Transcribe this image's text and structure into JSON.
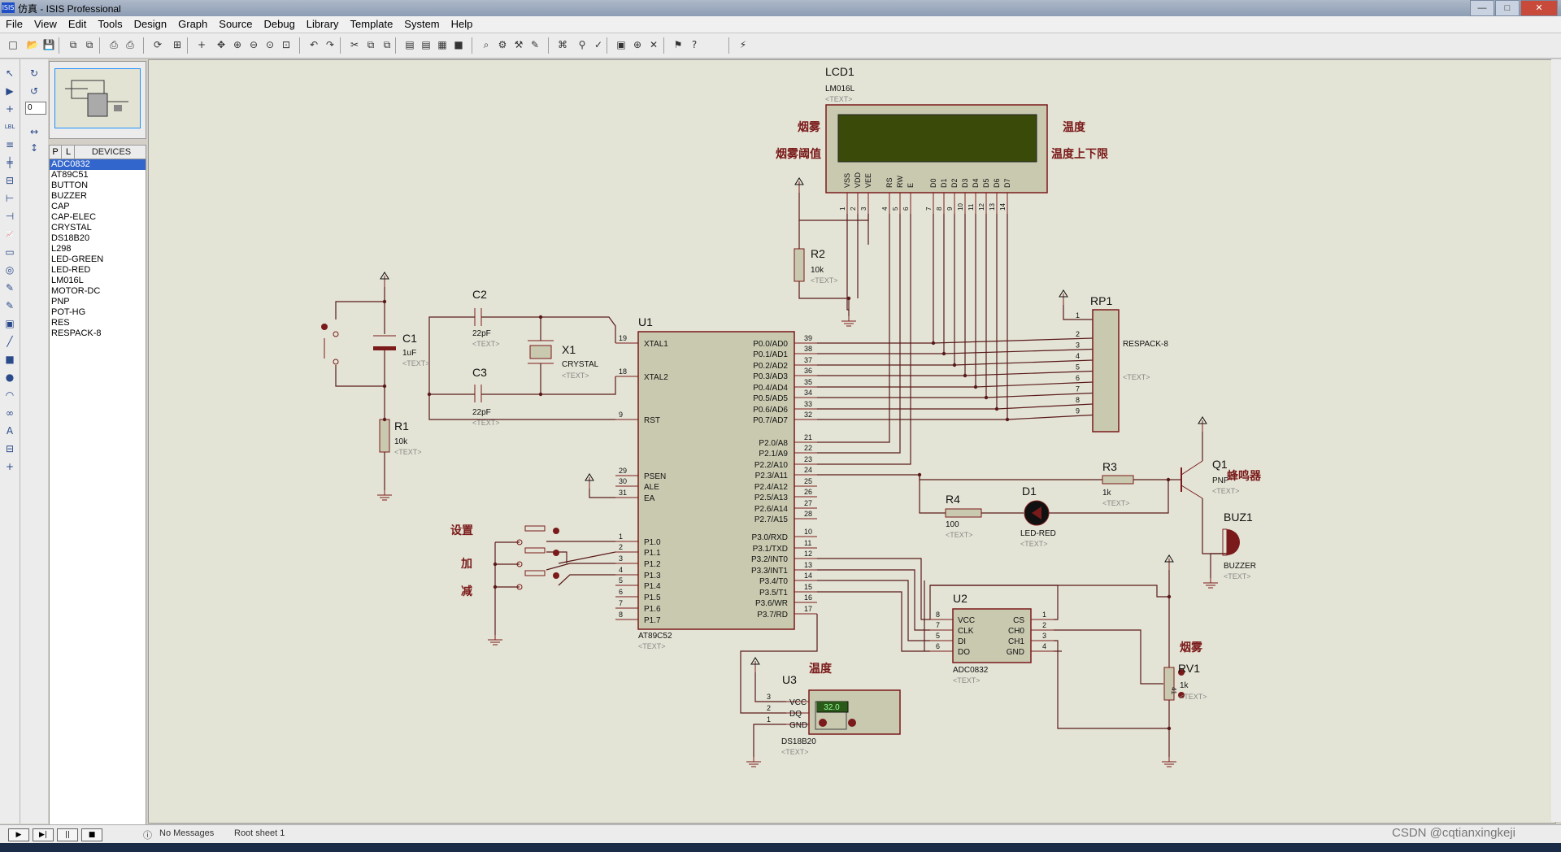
{
  "window": {
    "title": "仿真 - ISIS Professional",
    "app_icon": "ISIS"
  },
  "menu": [
    "File",
    "View",
    "Edit",
    "Tools",
    "Design",
    "Graph",
    "Source",
    "Debug",
    "Library",
    "Template",
    "System",
    "Help"
  ],
  "rotation_value": "0",
  "device_tabs": {
    "p": "P",
    "l": "L",
    "label": "DEVICES"
  },
  "devices": [
    "ADC0832",
    "AT89C51",
    "BUTTON",
    "BUZZER",
    "CAP",
    "CAP-ELEC",
    "CRYSTAL",
    "DS18B20",
    "L298",
    "LED-GREEN",
    "LED-RED",
    "LM016L",
    "MOTOR-DC",
    "PNP",
    "POT-HG",
    "RES",
    "RESPACK-8"
  ],
  "selected_device": "ADC0832",
  "schematic": {
    "text_placeholder": "<TEXT>",
    "lcd": {
      "ref": "LCD1",
      "part": "LM016L",
      "label_smoke": "烟雾",
      "label_smoke_th": "烟雾阈值",
      "label_temp": "温度",
      "label_temp_lim": "温度上下限",
      "pins": [
        "VSS",
        "VDD",
        "VEE",
        "RS",
        "RW",
        "E",
        "D0",
        "D1",
        "D2",
        "D3",
        "D4",
        "D5",
        "D6",
        "D7"
      ],
      "pin_numbers": [
        "1",
        "2",
        "3",
        "4",
        "5",
        "6",
        "7",
        "8",
        "9",
        "10",
        "11",
        "12",
        "13",
        "14"
      ]
    },
    "r2": {
      "ref": "R2",
      "value": "10k"
    },
    "rp1": {
      "ref": "RP1",
      "part": "RESPACK-8",
      "pins": [
        "1",
        "2",
        "3",
        "4",
        "5",
        "6",
        "7",
        "8",
        "9"
      ]
    },
    "c1": {
      "ref": "C1",
      "value": "1uF"
    },
    "c2": {
      "ref": "C2",
      "value": "22pF"
    },
    "c3": {
      "ref": "C3",
      "value": "22pF"
    },
    "x1": {
      "ref": "X1",
      "part": "CRYSTAL"
    },
    "r1": {
      "ref": "R1",
      "value": "10k"
    },
    "u1": {
      "ref": "U1",
      "part": "AT89C52",
      "left_pins": [
        {
          "n": "19",
          "name": "XTAL1"
        },
        {
          "n": "18",
          "name": "XTAL2"
        },
        {
          "n": "9",
          "name": "RST"
        },
        {
          "n": "29",
          "name": "PSEN"
        },
        {
          "n": "30",
          "name": "ALE"
        },
        {
          "n": "31",
          "name": "EA"
        },
        {
          "n": "1",
          "name": "P1.0"
        },
        {
          "n": "2",
          "name": "P1.1"
        },
        {
          "n": "3",
          "name": "P1.2"
        },
        {
          "n": "4",
          "name": "P1.3"
        },
        {
          "n": "5",
          "name": "P1.4"
        },
        {
          "n": "6",
          "name": "P1.5"
        },
        {
          "n": "7",
          "name": "P1.6"
        },
        {
          "n": "8",
          "name": "P1.7"
        }
      ],
      "right_pins": [
        {
          "n": "39",
          "name": "P0.0/AD0"
        },
        {
          "n": "38",
          "name": "P0.1/AD1"
        },
        {
          "n": "37",
          "name": "P0.2/AD2"
        },
        {
          "n": "36",
          "name": "P0.3/AD3"
        },
        {
          "n": "35",
          "name": "P0.4/AD4"
        },
        {
          "n": "34",
          "name": "P0.5/AD5"
        },
        {
          "n": "33",
          "name": "P0.6/AD6"
        },
        {
          "n": "32",
          "name": "P0.7/AD7"
        },
        {
          "n": "21",
          "name": "P2.0/A8"
        },
        {
          "n": "22",
          "name": "P2.1/A9"
        },
        {
          "n": "23",
          "name": "P2.2/A10"
        },
        {
          "n": "24",
          "name": "P2.3/A11"
        },
        {
          "n": "25",
          "name": "P2.4/A12"
        },
        {
          "n": "26",
          "name": "P2.5/A13"
        },
        {
          "n": "27",
          "name": "P2.6/A14"
        },
        {
          "n": "28",
          "name": "P2.7/A15"
        },
        {
          "n": "10",
          "name": "P3.0/RXD"
        },
        {
          "n": "11",
          "name": "P3.1/TXD"
        },
        {
          "n": "12",
          "name": "P3.2/INT0"
        },
        {
          "n": "13",
          "name": "P3.3/INT1"
        },
        {
          "n": "14",
          "name": "P3.4/T0"
        },
        {
          "n": "15",
          "name": "P3.5/T1"
        },
        {
          "n": "16",
          "name": "P3.6/WR"
        },
        {
          "n": "17",
          "name": "P3.7/RD"
        }
      ]
    },
    "buttons": {
      "set": "设置",
      "add": "加",
      "sub": "减"
    },
    "r3": {
      "ref": "R3",
      "value": "1k"
    },
    "q1": {
      "ref": "Q1",
      "part": "PNP",
      "label": "蜂鸣器"
    },
    "r4": {
      "ref": "R4",
      "value": "100"
    },
    "d1": {
      "ref": "D1",
      "part": "LED-RED"
    },
    "buz1": {
      "ref": "BUZ1",
      "part": "BUZZER"
    },
    "u2": {
      "ref": "U2",
      "part": "ADC0832",
      "left_pins": [
        {
          "n": "8",
          "name": "VCC"
        },
        {
          "n": "7",
          "name": "CLK"
        },
        {
          "n": "5",
          "name": "DI"
        },
        {
          "n": "6",
          "name": "DO"
        }
      ],
      "right_pins": [
        {
          "n": "1",
          "name": "CS"
        },
        {
          "n": "2",
          "name": "CH0"
        },
        {
          "n": "3",
          "name": "CH1"
        },
        {
          "n": "4",
          "name": "GND"
        }
      ]
    },
    "rv1": {
      "ref": "RV1",
      "value": "1k",
      "label": "烟雾",
      "dial": "41"
    },
    "u3": {
      "ref": "U3",
      "part": "DS18B20",
      "label": "温度",
      "display": "32.0",
      "pins": [
        {
          "n": "3",
          "name": "VCC"
        },
        {
          "n": "2",
          "name": "DQ"
        },
        {
          "n": "1",
          "name": "GND"
        }
      ]
    }
  },
  "status": {
    "messages": "No Messages",
    "sheet": "Root sheet 1"
  },
  "watermark": "CSDN @cqtianxingkeji"
}
